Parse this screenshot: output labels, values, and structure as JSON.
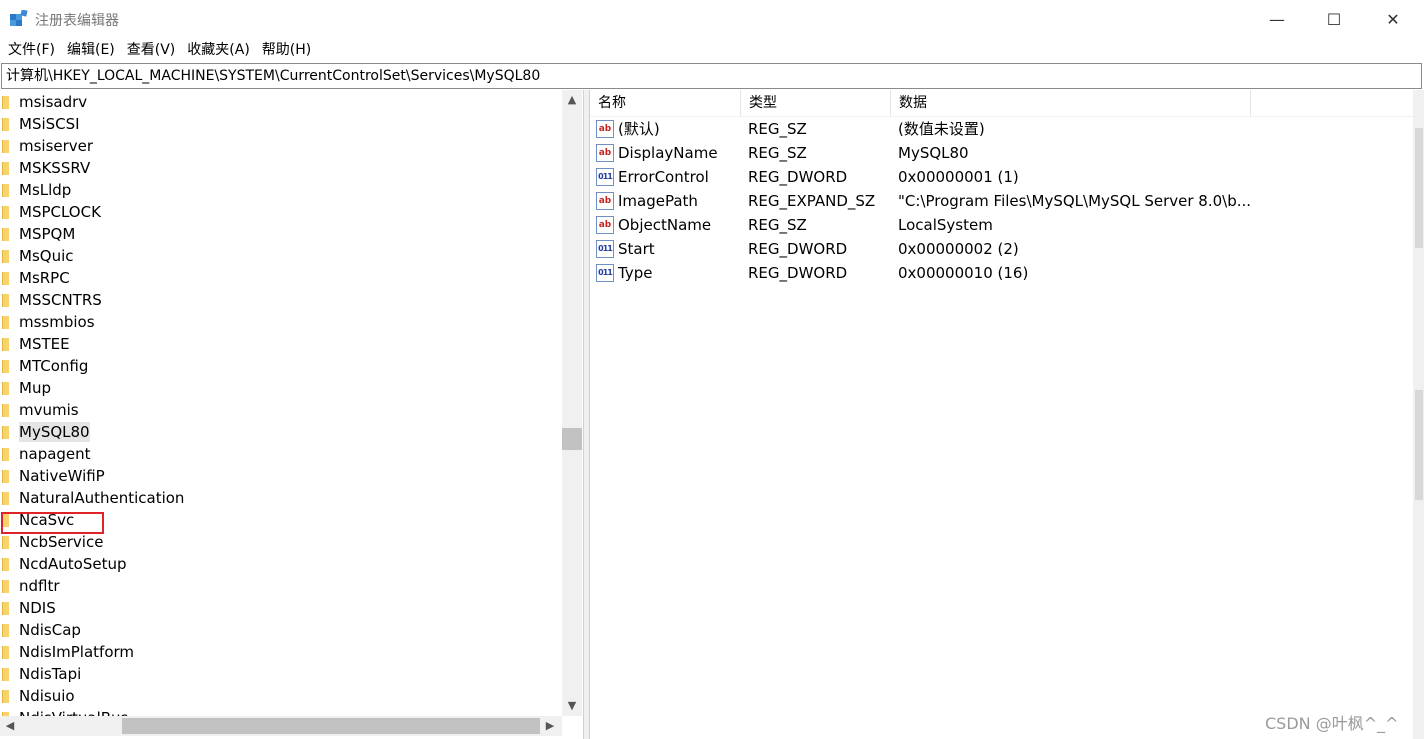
{
  "window": {
    "title": "注册表编辑器",
    "min_glyph": "—",
    "max_glyph": "☐",
    "close_glyph": "✕"
  },
  "menu": [
    "文件(F)",
    "编辑(E)",
    "查看(V)",
    "收藏夹(A)",
    "帮助(H)"
  ],
  "address": "计算机\\HKEY_LOCAL_MACHINE\\SYSTEM\\CurrentControlSet\\Services\\MySQL80",
  "tree": {
    "items": [
      "msisadrv",
      "MSiSCSI",
      "msiserver",
      "MSKSSRV",
      "MsLldp",
      "MSPCLOCK",
      "MSPQM",
      "MsQuic",
      "MsRPC",
      "MSSCNTRS",
      "mssmbios",
      "MSTEE",
      "MTConfig",
      "Mup",
      "mvumis",
      "MySQL80",
      "napagent",
      "NativeWifiP",
      "NaturalAuthentication",
      "NcaSvc",
      "NcbService",
      "NcdAutoSetup",
      "ndfltr",
      "NDIS",
      "NdisCap",
      "NdisImPlatform",
      "NdisTapi",
      "Ndisuio",
      "NdisVirtualBus"
    ],
    "selected": "MySQL80"
  },
  "scroll_glyphs": {
    "up": "▲",
    "down": "▼",
    "left": "◀",
    "right": "▶"
  },
  "values": {
    "headers": {
      "name": "名称",
      "type": "类型",
      "data": "数据"
    },
    "rows": [
      {
        "icon": "ab",
        "name": "(默认)",
        "type": "REG_SZ",
        "data": "(数值未设置)"
      },
      {
        "icon": "ab",
        "name": "DisplayName",
        "type": "REG_SZ",
        "data": "MySQL80"
      },
      {
        "icon": "bin",
        "name": "ErrorControl",
        "type": "REG_DWORD",
        "data": "0x00000001 (1)"
      },
      {
        "icon": "ab",
        "name": "ImagePath",
        "type": "REG_EXPAND_SZ",
        "data": "\"C:\\Program Files\\MySQL\\MySQL Server 8.0\\b..."
      },
      {
        "icon": "ab",
        "name": "ObjectName",
        "type": "REG_SZ",
        "data": "LocalSystem"
      },
      {
        "icon": "bin",
        "name": "Start",
        "type": "REG_DWORD",
        "data": "0x00000002 (2)"
      },
      {
        "icon": "bin",
        "name": "Type",
        "type": "REG_DWORD",
        "data": "0x00000010 (16)"
      }
    ],
    "icon_labels": {
      "ab": "ab",
      "bin": "011"
    }
  },
  "watermark": "CSDN @叶枫^_^"
}
